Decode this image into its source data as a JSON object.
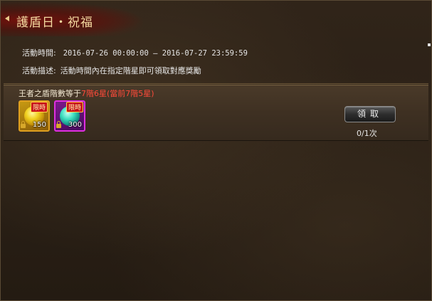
{
  "title": "護盾日・祝福",
  "event": {
    "time_label": "活動時間:",
    "time_value": "2016-07-26 00:00:00  –  2016-07-27 23:59:59",
    "desc_label": "活動描述:",
    "desc_value": "活動時間內在指定階星即可領取對應獎勵"
  },
  "task": {
    "condition_prefix": "王者之盾階數等于",
    "condition_highlight": "7階6星(當前7階5星)",
    "rewards": [
      {
        "icon": "yellow-gem-icon",
        "tag": "限時",
        "count": "150"
      },
      {
        "icon": "teal-gem-icon",
        "tag": "限時",
        "count": "300"
      }
    ],
    "claim_label": "領取",
    "claim_count": "0/1次"
  },
  "colors": {
    "title": "#f3d9a0",
    "highlight": "#ff4a3a"
  }
}
